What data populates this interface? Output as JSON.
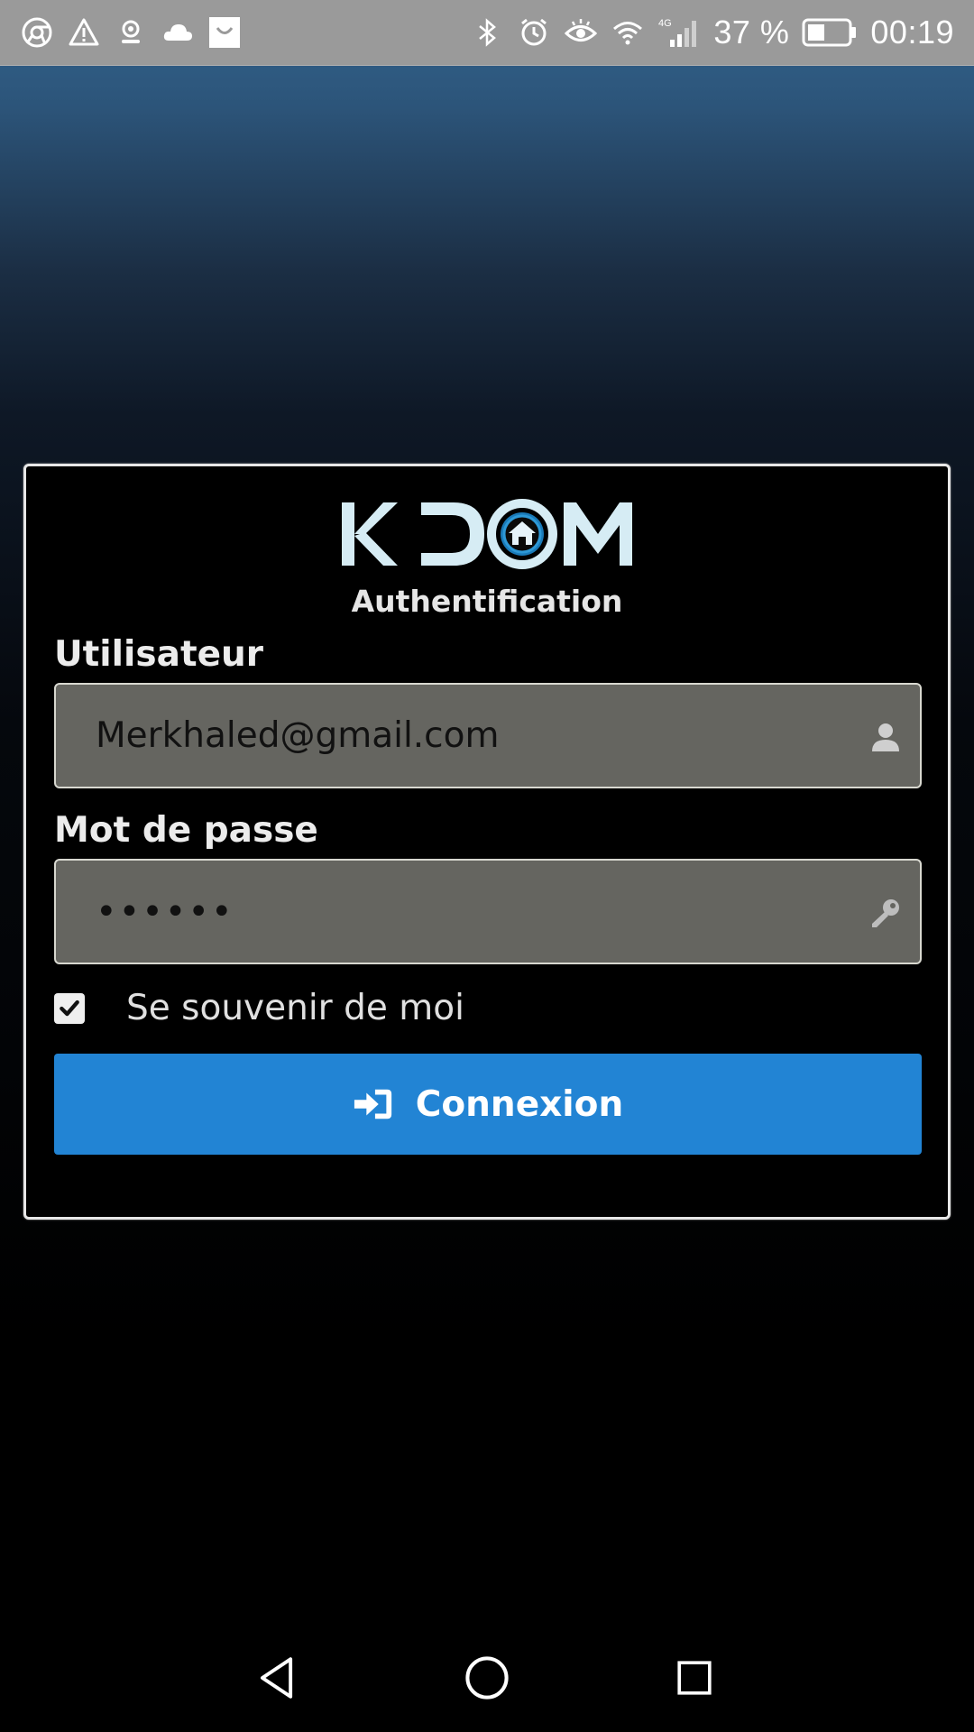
{
  "status_bar": {
    "left_icons": [
      "chrome-icon",
      "warning-icon",
      "location-icon",
      "cloud-icon",
      "shopping-bag-icon"
    ],
    "right_icons": [
      "bluetooth-icon",
      "alarm-icon",
      "eye-icon",
      "wifi-icon",
      "signal-icon"
    ],
    "network": "4G",
    "battery_percent": "37 %",
    "time": "00:19"
  },
  "login": {
    "logo_text": "KDOM",
    "title": "Authentification",
    "user_label": "Utilisateur",
    "user_value": "Merkhaled@gmail.com",
    "password_label": "Mot de passe",
    "password_value": "••••••",
    "remember_label": "Se souvenir de moi",
    "remember_checked": true,
    "submit_label": "Connexion"
  },
  "colors": {
    "accent": "#2284d4",
    "input_bg": "#656560",
    "status_bar_bg": "#9a9a9a"
  },
  "nav": [
    "back-icon",
    "home-icon",
    "recents-icon"
  ]
}
